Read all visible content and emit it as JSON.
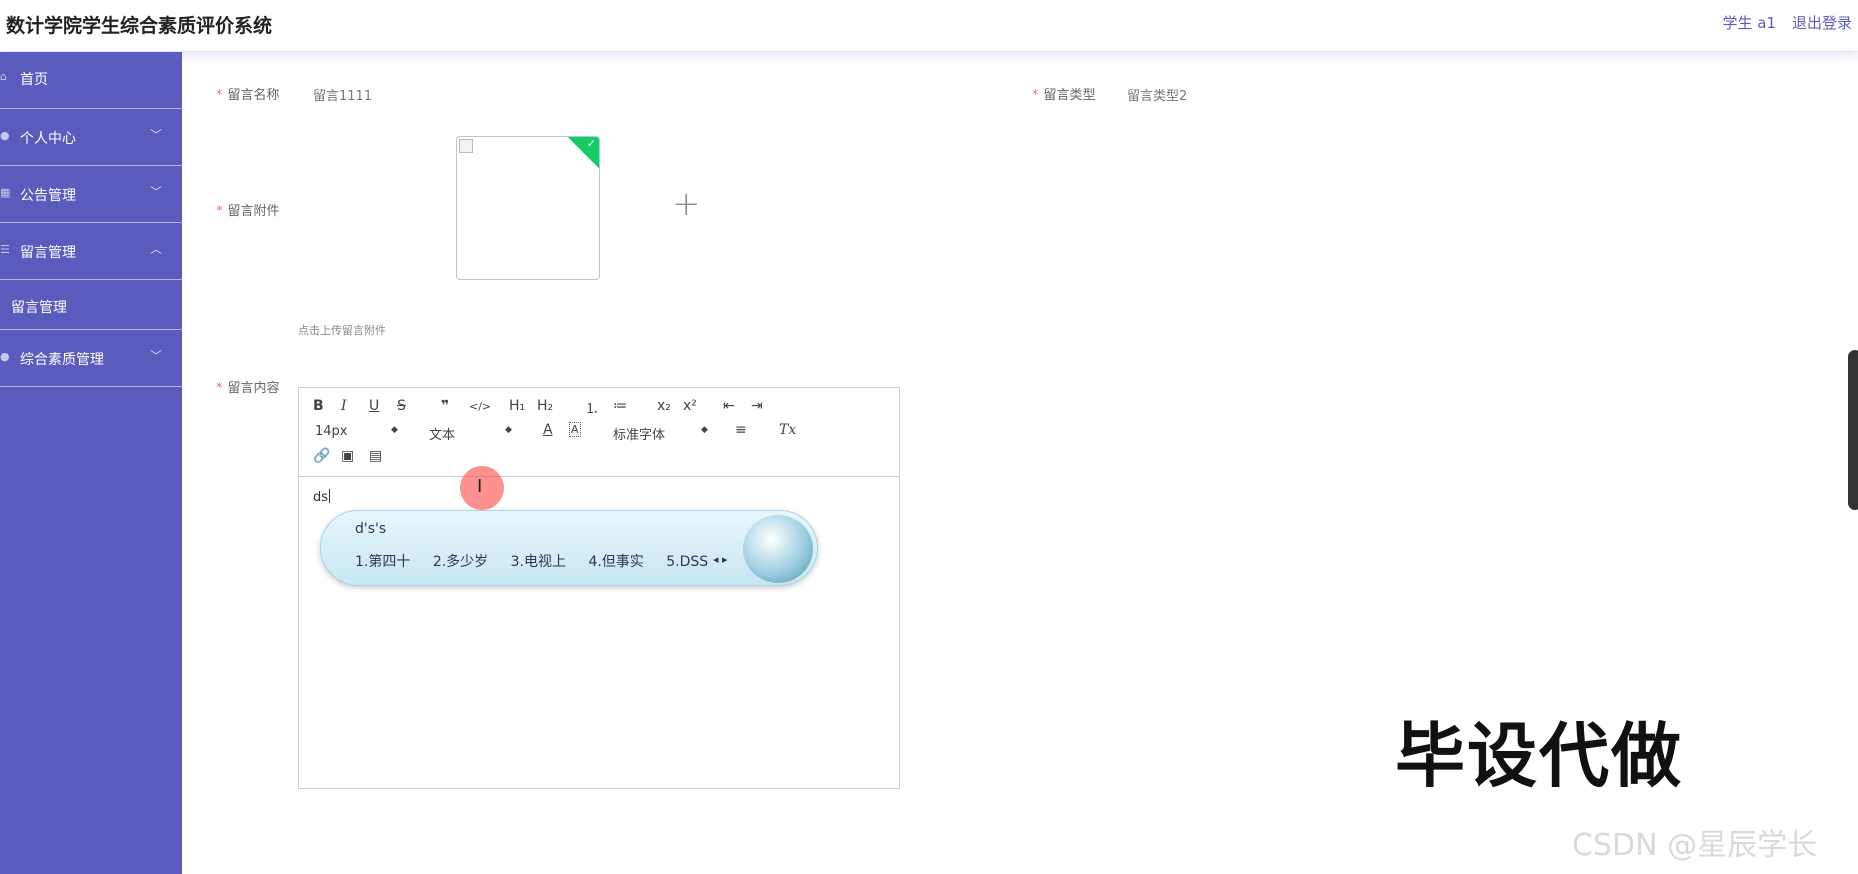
{
  "header": {
    "title": "数计学院学生综合素质评价系统",
    "user": "学生 a1",
    "logout": "退出登录"
  },
  "sidebar": {
    "items": [
      {
        "label": "首页",
        "icon": "home-icon"
      },
      {
        "label": "个人中心",
        "icon": "user-icon",
        "expanded": false
      },
      {
        "label": "公告管理",
        "icon": "grid-icon",
        "expanded": false
      },
      {
        "label": "留言管理",
        "icon": "list-icon",
        "expanded": true,
        "sub": "留言管理"
      },
      {
        "label": "综合素质管理",
        "icon": "bulb-icon",
        "expanded": false
      }
    ]
  },
  "form": {
    "name_label": "留言名称",
    "name_value": "留言1111",
    "type_label": "留言类型",
    "type_value": "留言类型2",
    "attach_label": "留言附件",
    "upload_tip": "点击上传留言附件",
    "content_label": "留言内容",
    "required_mark": "*"
  },
  "editor": {
    "toolbar": {
      "bold": "B",
      "italic": "I",
      "underline": "U",
      "strike": "S",
      "quote": "❞",
      "code": "</>",
      "h1": "H₁",
      "h2": "H₂",
      "ol": "⒈",
      "ul": "≔",
      "sub": "x₂",
      "sup": "x²",
      "outdent": "⇤",
      "indent": "⇥",
      "size": "14px",
      "header": "文本",
      "color": "A",
      "bg": "A",
      "font": "标准字体",
      "align": "≡",
      "clean": "Tx"
    },
    "content": "ds"
  },
  "ime": {
    "composition": "d's's",
    "candidates": [
      "1.第四十",
      "2.多少岁",
      "3.电视上",
      "4.但事实",
      "5.DSS"
    ],
    "pager": "◂ ▸"
  },
  "overlay": {
    "big_text": "毕设代做",
    "csdn": "CSDN @星辰学长"
  }
}
